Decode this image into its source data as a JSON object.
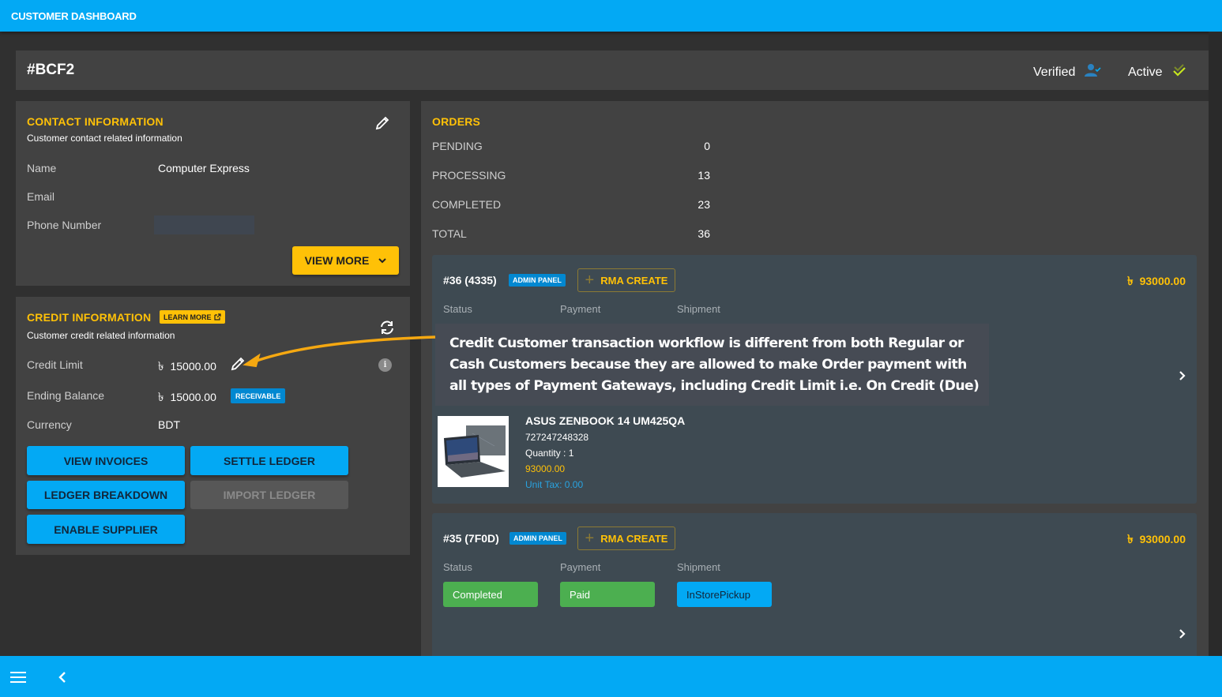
{
  "app": {
    "title": "CUSTOMER DASHBOARD"
  },
  "customer": {
    "id": "#BCF2",
    "verified_label": "Verified",
    "active_label": "Active"
  },
  "contact": {
    "title": "CONTACT INFORMATION",
    "subtitle": "Customer contact related information",
    "fields": [
      {
        "label": "Name",
        "value": "Computer Express"
      },
      {
        "label": "Email",
        "value": ""
      },
      {
        "label": "Phone Number",
        "value": ""
      }
    ],
    "view_more_label": "VIEW MORE"
  },
  "credit": {
    "title": "CREDIT INFORMATION",
    "learn_more_label": "LEARN MORE",
    "subtitle": "Customer credit related information",
    "currency_symbol": "৳",
    "credit_limit_label": "Credit Limit",
    "credit_limit_value": "15000.00",
    "ending_balance_label": "Ending Balance",
    "ending_balance_value": "15000.00",
    "ending_balance_badge": "RECEIVABLE",
    "currency_label": "Currency",
    "currency_value": "BDT",
    "buttons": {
      "view_invoices": "VIEW INVOICES",
      "settle_ledger": "SETTLE LEDGER",
      "ledger_breakdown": "LEDGER BREAKDOWN",
      "import_ledger": "IMPORT LEDGER",
      "enable_supplier": "ENABLE SUPPLIER"
    }
  },
  "orders": {
    "title": "ORDERS",
    "summary": [
      {
        "label": "PENDING",
        "count": "0"
      },
      {
        "label": "PROCESSING",
        "count": "13"
      },
      {
        "label": "COMPLETED",
        "count": "23"
      },
      {
        "label": "TOTAL",
        "count": "36"
      }
    ],
    "column_labels": {
      "status": "Status",
      "payment": "Payment",
      "shipment": "Shipment"
    },
    "list": [
      {
        "id": "#36 (4335)",
        "source_badge": "ADMIN PANEL",
        "rma_label": "RMA CREATE",
        "amount": "93000.00",
        "status": "",
        "payment": "",
        "shipment": "",
        "item": {
          "name": "ASUS ZENBOOK 14 UM425QA",
          "sku": "727247248328",
          "quantity": "Quantity : 1",
          "price": "93000.00",
          "unit_tax": "Unit Tax: 0.00"
        }
      },
      {
        "id": "#35 (7F0D)",
        "source_badge": "ADMIN PANEL",
        "rma_label": "RMA CREATE",
        "amount": "93000.00",
        "status": "Completed",
        "payment": "Paid",
        "shipment": "InStorePickup"
      }
    ]
  },
  "annotation": {
    "text": "Credit Customer transaction workflow is different from both Regular or Cash Customers because they are allowed to make Order payment with all types of Payment Gateways, including Credit Limit i.e. On Credit (Due)"
  },
  "colors": {
    "primary": "#03a9f4",
    "accent": "#ffc107",
    "success": "#4caf50",
    "badge_blue": "#0288d1",
    "panel": "#424242",
    "background": "#303030"
  }
}
